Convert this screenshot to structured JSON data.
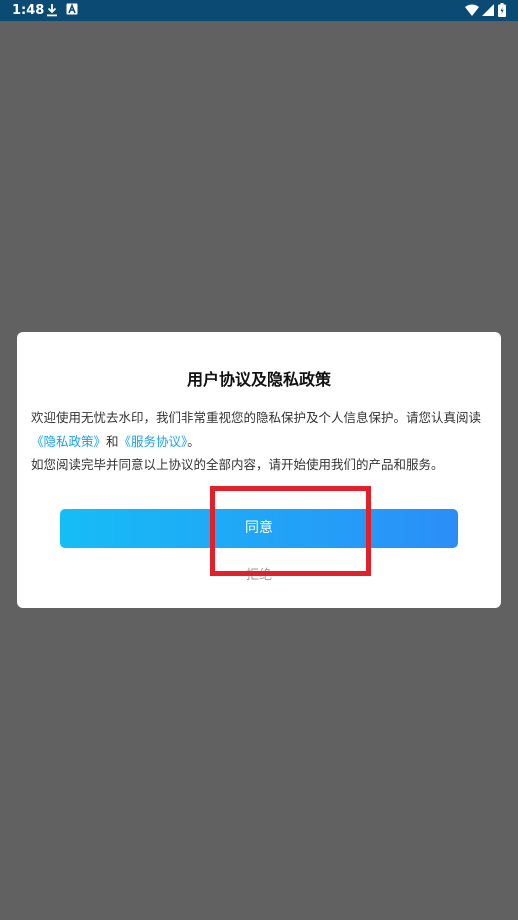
{
  "status_bar": {
    "time": "1:48",
    "icons": [
      "download-icon",
      "a-icon",
      "wifi-icon",
      "signal-icon",
      "battery-icon"
    ]
  },
  "dialog": {
    "title": "用户协议及隐私政策",
    "body_line1": "欢迎使用无忧去水印，我们非常重视您的隐私保护及个人信息保护。请您认真阅读",
    "privacy_link": "《隐私政策》",
    "conjunction": "和",
    "service_link": "《服务协议》",
    "period": "。",
    "body_line3": "如您阅读完毕并同意以上协议的全部内容，请开始使用我们的产品和服务。",
    "agree_label": "同意",
    "reject_label": "拒绝"
  },
  "colors": {
    "overlay": "#616161",
    "status_bar": "#0a4a73",
    "link": "#1aa3e8",
    "button_gradient_start": "#16bdf6",
    "button_gradient_end": "#2b8ef8",
    "highlight": "#e1202a"
  }
}
